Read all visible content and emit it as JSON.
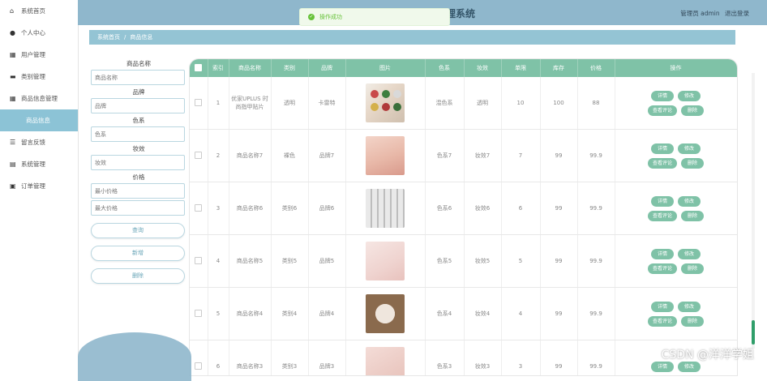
{
  "sidebar": {
    "items": [
      {
        "label": "系统首页",
        "icon": "home-icon",
        "glyph": "⌂"
      },
      {
        "label": "个人中心",
        "icon": "user-icon",
        "glyph": "●"
      },
      {
        "label": "用户管理",
        "icon": "grid-icon",
        "glyph": "▦"
      },
      {
        "label": "类别管理",
        "icon": "card-icon",
        "glyph": "▬"
      },
      {
        "label": "商品信息管理",
        "icon": "apps-icon",
        "glyph": "▦"
      },
      {
        "label": "商品信息",
        "icon": "",
        "glyph": ""
      },
      {
        "label": "留言反馈",
        "icon": "list-icon",
        "glyph": "☰"
      },
      {
        "label": "系统管理",
        "icon": "doc-icon",
        "glyph": "▤"
      },
      {
        "label": "订单管理",
        "icon": "order-icon",
        "glyph": "▣"
      }
    ]
  },
  "header": {
    "title": "管理系统",
    "user_label": "管理员 admin",
    "logout_label": "退出登录"
  },
  "toast": {
    "text": "操作成功"
  },
  "breadcrumb": {
    "home": "系统首页",
    "current": "商品信息"
  },
  "filters": {
    "name_label": "商品名称",
    "name_placeholder": "商品名称",
    "brand_label": "品牌",
    "brand_placeholder": "品牌",
    "color_label": "色系",
    "color_placeholder": "色系",
    "effect_label": "妆效",
    "effect_placeholder": "妆效",
    "price_label": "价格",
    "price_min_placeholder": "最小价格",
    "price_max_placeholder": "最大价格",
    "query_btn": "查询",
    "add_btn": "新增",
    "delete_btn": "删除"
  },
  "table": {
    "headers": [
      "索引",
      "商品名称",
      "类别",
      "品牌",
      "图片",
      "色系",
      "妆效",
      "单限",
      "库存",
      "价格",
      "操作"
    ],
    "rows": [
      {
        "index": "1",
        "name": "优家UPLUS 时尚指甲贴片",
        "category": "透明",
        "brand": "卡雷特",
        "color": "混色系",
        "effect": "透明",
        "limit": "10",
        "stock": "100",
        "price": "88"
      },
      {
        "index": "2",
        "name": "商品名称7",
        "category": "裸色",
        "brand": "品牌7",
        "color": "色系7",
        "effect": "妆效7",
        "limit": "7",
        "stock": "99",
        "price": "99.9"
      },
      {
        "index": "3",
        "name": "商品名称6",
        "category": "类别6",
        "brand": "品牌6",
        "color": "色系6",
        "effect": "妆效6",
        "limit": "6",
        "stock": "99",
        "price": "99.9"
      },
      {
        "index": "4",
        "name": "商品名称5",
        "category": "类别5",
        "brand": "品牌5",
        "color": "色系5",
        "effect": "妆效5",
        "limit": "5",
        "stock": "99",
        "price": "99.9"
      },
      {
        "index": "5",
        "name": "商品名称4",
        "category": "类别4",
        "brand": "品牌4",
        "color": "色系4",
        "effect": "妆效4",
        "limit": "4",
        "stock": "99",
        "price": "99.9"
      },
      {
        "index": "6",
        "name": "商品名称3",
        "category": "类别3",
        "brand": "品牌3",
        "color": "色系3",
        "effect": "妆效3",
        "limit": "3",
        "stock": "99",
        "price": "99.9"
      }
    ],
    "actions": {
      "detail": "详情",
      "edit": "修改",
      "reviews": "查看评论",
      "delete": "删除"
    }
  },
  "watermark": "CSDN @洋洋学姐",
  "colors": {
    "accent": "#7fc2a7",
    "topbar": "#8fb7cc",
    "breadcrumb": "#94c4d4",
    "sidebar_active": "#8cc3d6"
  }
}
